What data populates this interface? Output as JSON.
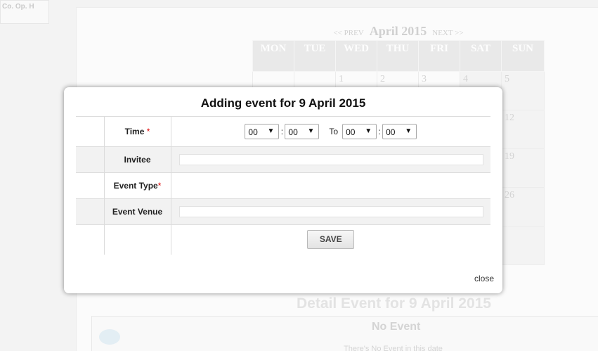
{
  "background": {
    "left_tag": "Co. Op. H",
    "calendar": {
      "prev_label": "<< PREV",
      "month_label": "April 2015",
      "next_label": "NEXT >>",
      "weekdays": [
        "MON",
        "TUE",
        "WED",
        "THU",
        "FRI",
        "SAT",
        "SUN"
      ],
      "rows": [
        [
          "",
          "",
          "1",
          "2",
          "3",
          "4",
          "5"
        ],
        [
          "",
          "",
          "",
          "",
          "",
          "",
          "12"
        ],
        [
          "",
          "",
          "",
          "",
          "",
          "",
          "19"
        ],
        [
          "",
          "",
          "",
          "",
          "",
          "",
          "26"
        ],
        [
          "",
          "",
          "",
          "",
          "",
          "",
          ""
        ]
      ]
    },
    "detail_title": "Detail Event for 9 April 2015",
    "no_event_title": "No Event",
    "no_event_subtitle": "There's No Event in this date"
  },
  "modal": {
    "title": "Adding event for 9 April 2015",
    "time_label": "Time",
    "required_mark": "*",
    "time_start_hour": "00",
    "time_start_minute": "00",
    "to_label": "To",
    "time_end_hour": "00",
    "time_end_minute": "00",
    "invitee_label": "Invitee",
    "invitee_value": "",
    "event_type_label": "Event Type",
    "event_venue_label": "Event Venue",
    "event_venue_value": "",
    "save_label": "SAVE",
    "close_label": "close",
    "dropdown_arrow": "▼",
    "colon": ":"
  }
}
